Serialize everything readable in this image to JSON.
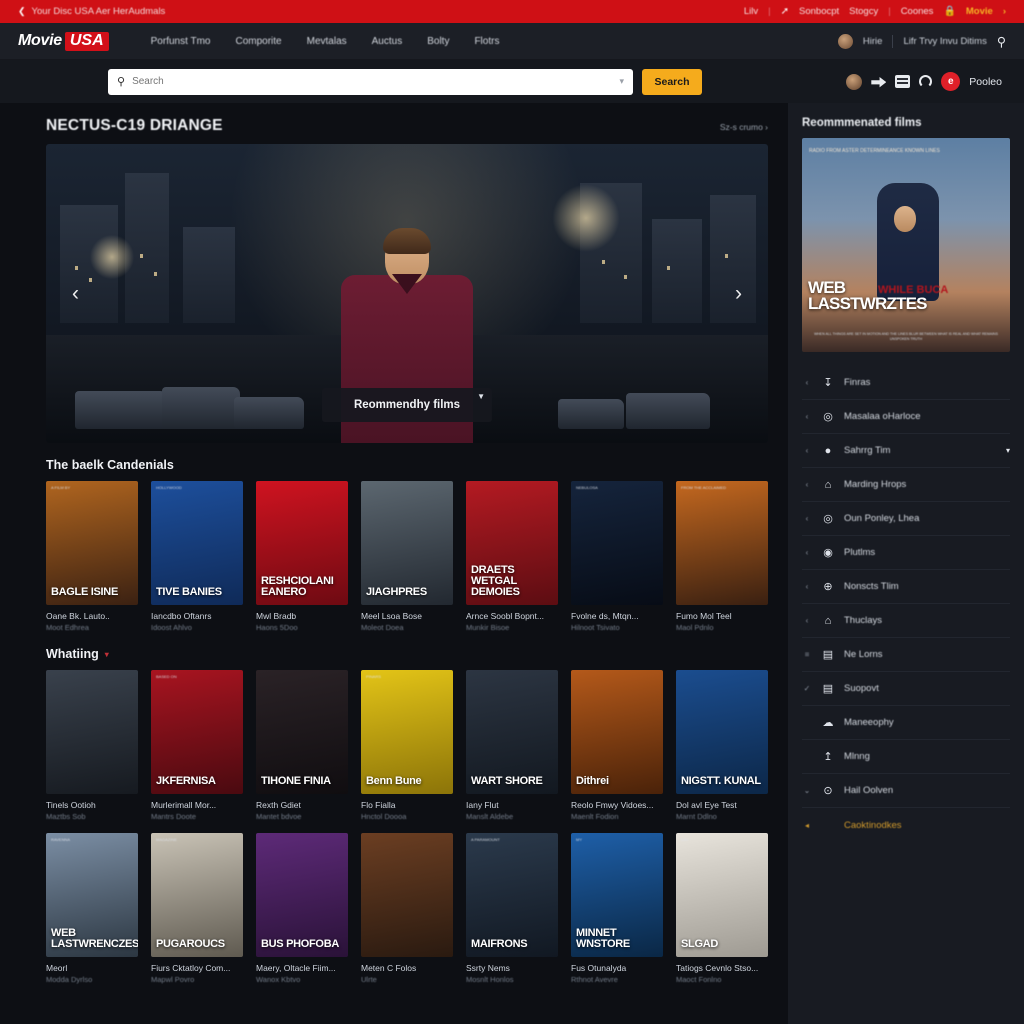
{
  "promo_bar": {
    "back_icon": "chevron-left-icon",
    "left_text": "Your Disc USA Aer HerAudmals",
    "right_items": [
      "Lilv",
      "Sonbocpt",
      "Stogcy",
      "Coones"
    ],
    "pin_icon": "pin-icon",
    "lock_icon": "lock-icon",
    "highlight": "Movie",
    "highlight_chevron": "›",
    "bg_color": "#cf1015",
    "highlight_color": "#f5b425"
  },
  "header": {
    "logo": {
      "word1": "Movie",
      "word2": "USA",
      "badge_color": "#d31019"
    },
    "nav": [
      "Porfunst Tmo",
      "Comporite",
      "Mevtalas",
      "Auctus",
      "Bolty",
      "Flotrs"
    ],
    "account_label": "Hirie",
    "secondary_label": "Lifr Trvy Invu Ditims",
    "search_icon": "search-icon",
    "avatar_icon": "avatar"
  },
  "search": {
    "placeholder": "Search",
    "value": "",
    "button_label": "Search",
    "button_color": "#f5ab1c",
    "magnifier_icon": "search-icon",
    "dropdown_icon": "chevron-down-icon",
    "quick_icons": [
      "share-icon",
      "card-icon",
      "refresh-icon"
    ],
    "user_badge": "e",
    "user_name": "Pooleo",
    "user_badge_color": "#e02029"
  },
  "hero": {
    "title": "NECTUS-C19 DRIANGE",
    "more_label": "Sz-s crumo ›",
    "cta_label": "Reommendhy films",
    "cta_badge_icon": "bookmark-icon",
    "prev_icon": "chevron-left-icon",
    "next_icon": "chevron-right-icon"
  },
  "sections": [
    {
      "title": "The baelk Candenials",
      "chevron": "",
      "items": [
        {
          "poster_text": "BAGLE ISINE",
          "poster_top": "A FILM BY",
          "title": "Oane Bk. Lauto..",
          "sub": "Moot Edhrea"
        },
        {
          "poster_text": "TIVE BANIES",
          "poster_top": "HOLLYWOOD",
          "title": "Iancdbo Oftanrs",
          "sub": "Idoost Ahlvo"
        },
        {
          "poster_text": "RESHCIOLANI EANERO",
          "poster_top": "",
          "title": "Mwl Bradb",
          "sub": "Haons 5Doo"
        },
        {
          "poster_text": "JIAGHPRES",
          "poster_top": "",
          "title": "Meel Lsoa Bose",
          "sub": "Moleot Doea"
        },
        {
          "poster_text": "DRAETS WETGAL DEMOIES",
          "poster_top": "",
          "title": "Arnce Soobl Bopnt...",
          "sub": "Munkir Bisoe"
        },
        {
          "poster_text": "",
          "poster_top": "NEBULOSA",
          "title": "Fvolne ds, Mtqn...",
          "sub": "Hilnoot Tsivato"
        },
        {
          "poster_text": "",
          "poster_top": "FROM THE ACCLAIMED",
          "title": "Fumo Mol Teel",
          "sub": "Maol Pdnlo"
        }
      ]
    },
    {
      "title": "Whatiing",
      "chevron": "▾",
      "items": [
        {
          "poster_text": "",
          "poster_top": "",
          "title": "Tinels Ootioh",
          "sub": "Maztbs Sob"
        },
        {
          "poster_text": "JKFERNISA",
          "poster_top": "BASED ON",
          "title": "Murlerimall Mor...",
          "sub": "Mantrs Doote"
        },
        {
          "poster_text": "TIHONE FINIA",
          "poster_top": "",
          "title": "Rexth Gdiet",
          "sub": "Mantet bdvoe"
        },
        {
          "poster_text": "Benn Bune",
          "poster_top": "PINARS",
          "title": "Flo Fialla",
          "sub": "Hnctol Doooa"
        },
        {
          "poster_text": "WART SHORE",
          "poster_top": "",
          "title": "Iany Flut",
          "sub": "Manslt Aldebe"
        },
        {
          "poster_text": "Dithrei",
          "poster_top": "",
          "title": "Reolo Fmwy Vidoes...",
          "sub": "Maenlt Fodion"
        },
        {
          "poster_text": "NIGSTT. KUNAL",
          "poster_top": "",
          "title": "Dol avl Eye Test",
          "sub": "Marnt Ddlno"
        }
      ]
    },
    {
      "title": "",
      "chevron": "",
      "items": [
        {
          "poster_text": "WEB LASTWRENCZES",
          "poster_top": "RAVENNA",
          "title": "Meorl",
          "sub": "Modda Dyrlso"
        },
        {
          "poster_text": "PUGAROUCS",
          "poster_top": "MAGAZINE",
          "title": "Fiurs Cktatloy Com...",
          "sub": "Mapwl Povro"
        },
        {
          "poster_text": "BUS PHOFOBA",
          "poster_top": "",
          "title": "Maery, Oltacle Fiim...",
          "sub": "Wanox Kbtvo"
        },
        {
          "poster_text": "",
          "poster_top": "",
          "title": "Meten C Folos",
          "sub": "Ulrte"
        },
        {
          "poster_text": "MAIFRONS",
          "poster_top": "A PARAMOUNT",
          "title": "Ssrty Nems",
          "sub": "Mosnlt Honlos"
        },
        {
          "poster_text": "MINNET WNSTORE",
          "poster_top": "MY",
          "title": "Fus Otunalyda",
          "sub": "Rthnot Avevre"
        },
        {
          "poster_text": "SLGAD",
          "poster_top": "DAY",
          "title": "Tatiogs Cevnlo Stso...",
          "sub": "Maoct Fonlno"
        }
      ]
    }
  ],
  "sidebar": {
    "title": "Reommmenated films",
    "poster": {
      "top_text": "RADIO FROM\nASTER\nDETERMINEANCE\nKNOWN LINES",
      "title_line1": "WEB",
      "title_line2": "LASSTWRZTES",
      "accent_text": "WHILE BUCA",
      "fine_print": "WHEN ALL THINGS ARE SET IN MOTION AND THE LINES BLUR\nBETWEEN WHAT IS REAL AND WHAT REMAINS UNSPOKEN TRUTH"
    },
    "items": [
      {
        "lead": "‹",
        "icon": "download-icon",
        "glyph": "↧",
        "label": "Finras",
        "tail": ""
      },
      {
        "lead": "‹",
        "icon": "steering-wheel-icon",
        "glyph": "◎",
        "label": "Masalaa oHarloce",
        "tail": ""
      },
      {
        "lead": "‹",
        "icon": "microphone-icon",
        "glyph": "●",
        "label": "Sahrrg Tim",
        "tail": "▾"
      },
      {
        "lead": "‹",
        "icon": "home-icon",
        "glyph": "⌂",
        "label": "Marding Hrops",
        "tail": ""
      },
      {
        "lead": "‹",
        "icon": "compass-icon",
        "glyph": "◎",
        "label": "Oun Ponley, Lhea",
        "tail": ""
      },
      {
        "lead": "‹",
        "icon": "record-icon",
        "glyph": "◉",
        "label": "Plutlms",
        "tail": ""
      },
      {
        "lead": "‹",
        "icon": "target-icon",
        "glyph": "⊕",
        "label": "Nonscts Tlim",
        "tail": ""
      },
      {
        "lead": "‹",
        "icon": "house-filled-icon",
        "glyph": "⌂",
        "label": "Thuclays",
        "tail": ""
      },
      {
        "lead": "≡",
        "icon": "list-icon",
        "glyph": "▤",
        "label": "Ne Lorns",
        "tail": ""
      },
      {
        "lead": "✓",
        "icon": "card-icon",
        "glyph": "▤",
        "label": "Suopovt",
        "tail": ""
      },
      {
        "lead": "",
        "icon": "cloud-icon",
        "glyph": "☁",
        "label": "Maneeophy",
        "tail": ""
      },
      {
        "lead": "",
        "icon": "upload-icon",
        "glyph": "↥",
        "label": "Mlnng",
        "tail": ""
      },
      {
        "lead": "⌄",
        "icon": "clock-icon",
        "glyph": "⊙",
        "label": "Hail Oolven",
        "tail": ""
      },
      {
        "lead": "◂",
        "icon": "",
        "glyph": "",
        "label": "Caoktinodkes",
        "tail": ""
      }
    ]
  }
}
